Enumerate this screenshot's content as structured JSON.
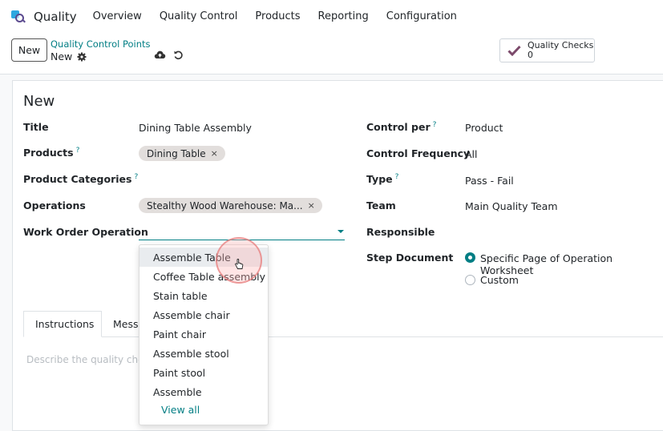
{
  "navbar": {
    "app_name": "Quality",
    "menu": [
      "Overview",
      "Quality Control",
      "Products",
      "Reporting",
      "Configuration"
    ]
  },
  "control_panel": {
    "new_button": "New",
    "breadcrumb_parent": "Quality Control Points",
    "breadcrumb_current": "New",
    "smart_button": {
      "label": "Quality Checks",
      "count": "0"
    }
  },
  "form": {
    "title": "New",
    "left": {
      "title_label": "Title",
      "title_value": "Dining Table Assembly",
      "products_label": "Products",
      "products_tags": [
        "Dining Table"
      ],
      "product_categories_label": "Product Categories",
      "operations_label": "Operations",
      "operations_tags": [
        "Stealthy Wood Warehouse: Ma..."
      ],
      "work_order_operation_label": "Work Order Operation",
      "help_mark": "?"
    },
    "right": {
      "control_per_label": "Control per",
      "control_per_value": "Product",
      "control_frequency_label": "Control Frequency",
      "control_frequency_value": "All",
      "type_label": "Type",
      "type_value": "Pass - Fail",
      "team_label": "Team",
      "team_value": "Main Quality Team",
      "responsible_label": "Responsible",
      "step_document_label": "Step Document",
      "step_document_options": [
        "Specific Page of Operation Worksheet",
        "Custom"
      ],
      "step_document_selected": "Specific Page of Operation Worksheet"
    }
  },
  "tag_remove_glyph": "×",
  "notebook": {
    "tabs": [
      "Instructions",
      "Messa"
    ],
    "active_tab": "Instructions",
    "instructions_placeholder": "Describe the quality che"
  },
  "dropdown": {
    "items": [
      "Assemble Table",
      "Coffee Table assembly",
      "Stain table",
      "Assemble chair",
      "Paint chair",
      "Assemble stool",
      "Paint stool",
      "Assemble"
    ],
    "highlighted": "Assemble Table",
    "view_all": "View all"
  },
  "colors": {
    "accent": "#017e84",
    "tag_bg": "#e2dedc",
    "check_icon": "#7c4a6b"
  }
}
